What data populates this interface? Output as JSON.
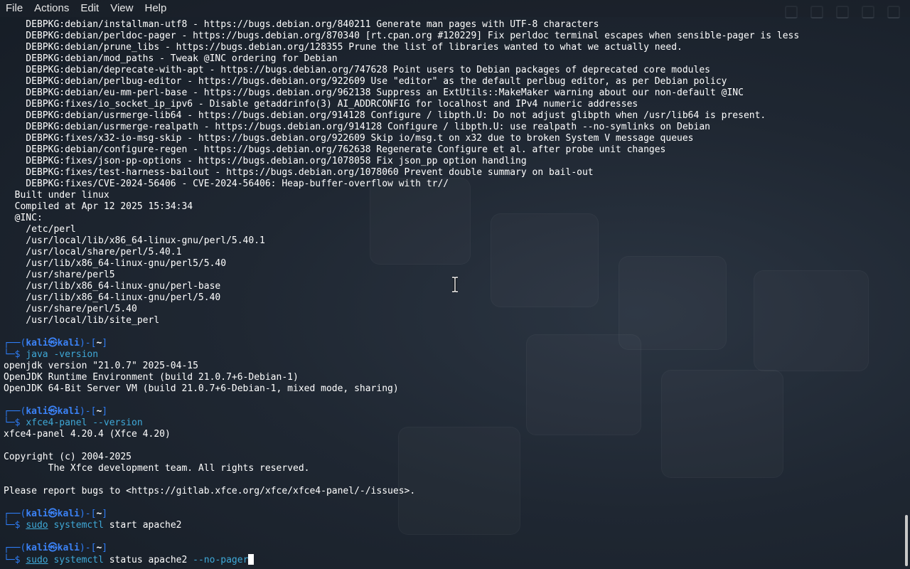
{
  "menubar": {
    "items": [
      "File",
      "Actions",
      "Edit",
      "View",
      "Help"
    ]
  },
  "terminal": {
    "lines": [
      {
        "type": "text",
        "text": "    DEBPKG:debian/installman-utf8 - https://bugs.debian.org/840211 Generate man pages with UTF-8 characters"
      },
      {
        "type": "text",
        "text": "    DEBPKG:debian/perldoc-pager - https://bugs.debian.org/870340 [rt.cpan.org #120229] Fix perldoc terminal escapes when sensible-pager is less"
      },
      {
        "type": "text",
        "text": "    DEBPKG:debian/prune_libs - https://bugs.debian.org/128355 Prune the list of libraries wanted to what we actually need."
      },
      {
        "type": "text",
        "text": "    DEBPKG:debian/mod_paths - Tweak @INC ordering for Debian"
      },
      {
        "type": "text",
        "text": "    DEBPKG:debian/deprecate-with-apt - https://bugs.debian.org/747628 Point users to Debian packages of deprecated core modules"
      },
      {
        "type": "text",
        "text": "    DEBPKG:debian/perlbug-editor - https://bugs.debian.org/922609 Use \"editor\" as the default perlbug editor, as per Debian policy"
      },
      {
        "type": "text",
        "text": "    DEBPKG:debian/eu-mm-perl-base - https://bugs.debian.org/962138 Suppress an ExtUtils::MakeMaker warning about our non-default @INC"
      },
      {
        "type": "text",
        "text": "    DEBPKG:fixes/io_socket_ip_ipv6 - Disable getaddrinfo(3) AI_ADDRCONFIG for localhost and IPv4 numeric addresses"
      },
      {
        "type": "text",
        "text": "    DEBPKG:debian/usrmerge-lib64 - https://bugs.debian.org/914128 Configure / libpth.U: Do not adjust glibpth when /usr/lib64 is present."
      },
      {
        "type": "text",
        "text": "    DEBPKG:debian/usrmerge-realpath - https://bugs.debian.org/914128 Configure / libpth.U: use realpath --no-symlinks on Debian"
      },
      {
        "type": "text",
        "text": "    DEBPKG:fixes/x32-io-msg-skip - https://bugs.debian.org/922609 Skip io/msg.t on x32 due to broken System V message queues"
      },
      {
        "type": "text",
        "text": "    DEBPKG:debian/configure-regen - https://bugs.debian.org/762638 Regenerate Configure et al. after probe unit changes"
      },
      {
        "type": "text",
        "text": "    DEBPKG:fixes/json-pp-options - https://bugs.debian.org/1078058 Fix json_pp option handling"
      },
      {
        "type": "text",
        "text": "    DEBPKG:fixes/test-harness-bailout - https://bugs.debian.org/1078060 Prevent double summary on bail-out"
      },
      {
        "type": "text",
        "text": "    DEBPKG:fixes/CVE-2024-56406 - CVE-2024-56406: Heap-buffer-overflow with tr//"
      },
      {
        "type": "text",
        "text": "  Built under linux"
      },
      {
        "type": "text",
        "text": "  Compiled at Apr 12 2025 15:34:34"
      },
      {
        "type": "text",
        "text": "  @INC:"
      },
      {
        "type": "text",
        "text": "    /etc/perl"
      },
      {
        "type": "text",
        "text": "    /usr/local/lib/x86_64-linux-gnu/perl/5.40.1"
      },
      {
        "type": "text",
        "text": "    /usr/local/share/perl/5.40.1"
      },
      {
        "type": "text",
        "text": "    /usr/lib/x86_64-linux-gnu/perl5/5.40"
      },
      {
        "type": "text",
        "text": "    /usr/share/perl5"
      },
      {
        "type": "text",
        "text": "    /usr/lib/x86_64-linux-gnu/perl-base"
      },
      {
        "type": "text",
        "text": "    /usr/lib/x86_64-linux-gnu/perl/5.40"
      },
      {
        "type": "text",
        "text": "    /usr/share/perl/5.40"
      },
      {
        "type": "text",
        "text": "    /usr/local/lib/site_perl"
      },
      {
        "type": "blank"
      },
      {
        "type": "prompt",
        "user": "kali",
        "sep": "㉿",
        "host": "kali",
        "dir": "~"
      },
      {
        "type": "command",
        "parts": [
          {
            "style": "bin",
            "text": "java"
          },
          {
            "style": "opt",
            "text": " -version"
          }
        ]
      },
      {
        "type": "text",
        "text": "openjdk version \"21.0.7\" 2025-04-15"
      },
      {
        "type": "text",
        "text": "OpenJDK Runtime Environment (build 21.0.7+6-Debian-1)"
      },
      {
        "type": "text",
        "text": "OpenJDK 64-Bit Server VM (build 21.0.7+6-Debian-1, mixed mode, sharing)"
      },
      {
        "type": "blank"
      },
      {
        "type": "prompt",
        "user": "kali",
        "sep": "㉿",
        "host": "kali",
        "dir": "~"
      },
      {
        "type": "command",
        "parts": [
          {
            "style": "bin",
            "text": "xfce4-panel"
          },
          {
            "style": "opt",
            "text": " --version"
          }
        ]
      },
      {
        "type": "text",
        "text": "xfce4-panel 4.20.4 (Xfce 4.20)"
      },
      {
        "type": "blank"
      },
      {
        "type": "text",
        "text": "Copyright (c) 2004-2025"
      },
      {
        "type": "text",
        "text": "        The Xfce development team. All rights reserved."
      },
      {
        "type": "blank"
      },
      {
        "type": "text",
        "text": "Please report bugs to <https://gitlab.xfce.org/xfce/xfce4-panel/-/issues>."
      },
      {
        "type": "blank"
      },
      {
        "type": "prompt",
        "user": "kali",
        "sep": "㉿",
        "host": "kali",
        "dir": "~"
      },
      {
        "type": "command",
        "parts": [
          {
            "style": "sudo",
            "text": "sudo"
          },
          {
            "style": "bin",
            "text": " systemctl"
          },
          {
            "style": "plain",
            "text": " start apache2"
          }
        ]
      },
      {
        "type": "blank"
      },
      {
        "type": "prompt",
        "user": "kali",
        "sep": "㉿",
        "host": "kali",
        "dir": "~"
      },
      {
        "type": "command",
        "cursor": true,
        "parts": [
          {
            "style": "sudo",
            "text": "sudo"
          },
          {
            "style": "bin",
            "text": " systemctl"
          },
          {
            "style": "plain",
            "text": " status apache2 "
          },
          {
            "style": "opt",
            "text": "--no-pager"
          }
        ]
      }
    ]
  },
  "colors": {
    "background": "#1e2631",
    "prompt_frame": "#2e7df6",
    "command": "#3fa9d8",
    "text": "#ffffff"
  },
  "icons": {
    "pointer": "ibeam-cursor-icon"
  }
}
